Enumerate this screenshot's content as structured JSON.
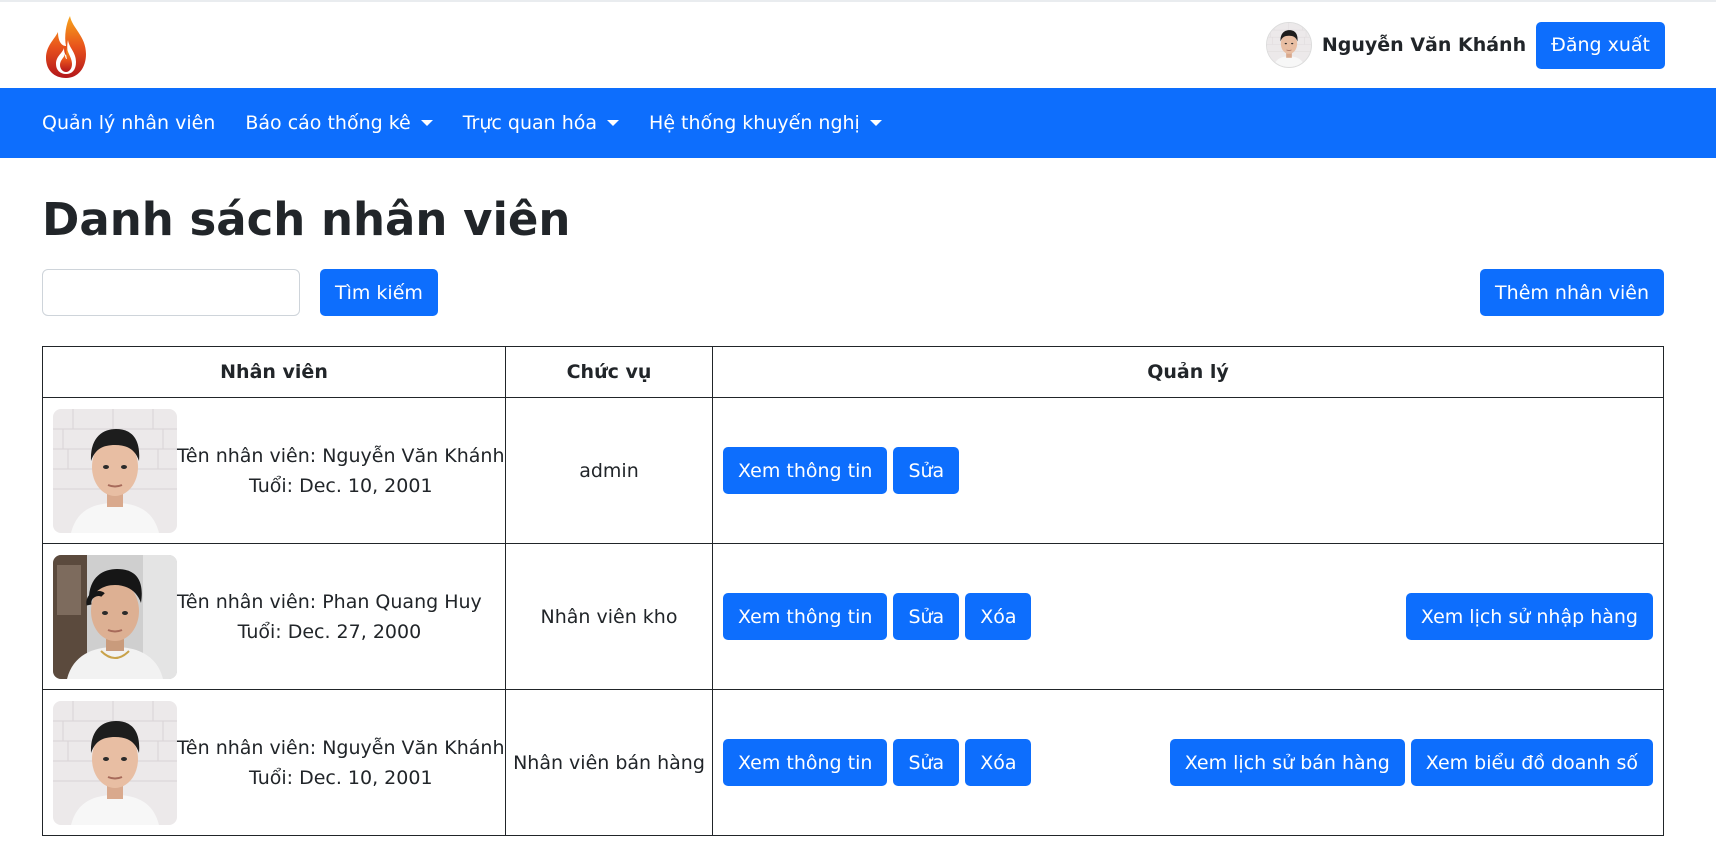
{
  "header": {
    "logo_icon": "flame-logo-icon",
    "username": "Nguyễn Văn Khánh",
    "logout_label": "Đăng xuất"
  },
  "nav": {
    "items": [
      {
        "label": "Quản lý nhân viên",
        "dropdown": false
      },
      {
        "label": "Báo cáo thống kê",
        "dropdown": true
      },
      {
        "label": "Trực quan hóa",
        "dropdown": true
      },
      {
        "label": "Hệ thống khuyến nghị",
        "dropdown": true
      }
    ]
  },
  "page": {
    "title": "Danh sách nhân viên",
    "search_value": "",
    "search_label": "Tìm kiếm",
    "add_label": "Thêm nhân viên"
  },
  "table": {
    "headers": [
      "Nhân viên",
      "Chức vụ",
      "Quản lý"
    ],
    "rows": [
      {
        "name_text": "Tên nhân viên: Nguyễn Văn Khánh",
        "age_text": "Tuổi: Dec. 10, 2001",
        "role": "admin",
        "view_label": "Xem thông tin",
        "edit_label": "Sửa"
      },
      {
        "name_text": "Tên nhân viên: Phan Quang Huy",
        "age_text": "Tuổi: Dec. 27, 2000",
        "role": "Nhân viên kho",
        "view_label": "Xem thông tin",
        "edit_label": "Sửa",
        "delete_label": "Xóa",
        "extra_1": "Xem lịch sử nhập hàng"
      },
      {
        "name_text": "Tên nhân viên: Nguyễn Văn Khánh",
        "age_text": "Tuổi: Dec. 10, 2001",
        "role": "Nhân viên bán hàng",
        "view_label": "Xem thông tin",
        "edit_label": "Sửa",
        "delete_label": "Xóa",
        "extra_1": "Xem lịch sử bán hàng",
        "extra_2": "Xem biểu đồ doanh số"
      }
    ]
  },
  "colors": {
    "primary": "#0d6efd",
    "text": "#212529"
  }
}
